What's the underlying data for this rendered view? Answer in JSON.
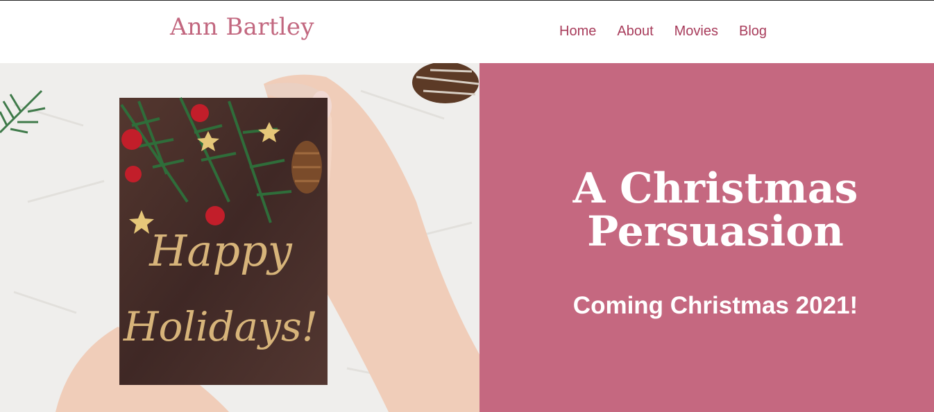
{
  "header": {
    "brand": "Ann Bartley",
    "nav": [
      "Home",
      "About",
      "Movies",
      "Blog"
    ]
  },
  "hero": {
    "image": {
      "card_text_line1": "Happy",
      "card_text_line2": "Holidays!"
    },
    "title_line1": "A Christmas",
    "title_line2": "Persuasion",
    "subtitle": "Coming Christmas 2021!"
  },
  "colors": {
    "brand": "#c2677f",
    "nav": "#a83c5b",
    "panel": "#c56880",
    "text_on_panel": "#ffffff"
  }
}
